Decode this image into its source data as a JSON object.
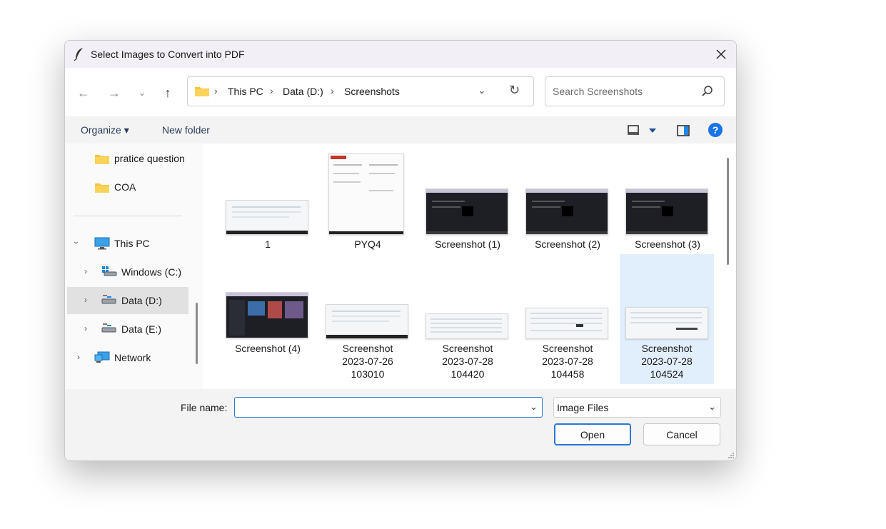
{
  "window": {
    "title": "Select Images to Convert into PDF"
  },
  "navigation": {
    "breadcrumb": [
      "This PC",
      "Data (D:)",
      "Screenshots"
    ],
    "search_placeholder": "Search Screenshots"
  },
  "toolbar": {
    "organize_label": "Organize ▾",
    "new_folder_label": "New folder"
  },
  "sidebar": {
    "items": [
      {
        "label": "pratice question",
        "icon": "folder-icon"
      },
      {
        "label": "COA",
        "icon": "folder-icon"
      },
      {
        "label": "This PC",
        "icon": "pc-icon"
      },
      {
        "label": "Windows (C:)",
        "icon": "drive-icon"
      },
      {
        "label": "Data (D:)",
        "icon": "drive-icon",
        "selected": true
      },
      {
        "label": "Data (E:)",
        "icon": "drive-icon"
      },
      {
        "label": "Network",
        "icon": "network-icon"
      }
    ]
  },
  "files": {
    "items": [
      {
        "name": "1",
        "name2": "",
        "name3": ""
      },
      {
        "name": "PYQ4",
        "name2": "",
        "name3": ""
      },
      {
        "name": "Screenshot (1)",
        "name2": "",
        "name3": ""
      },
      {
        "name": "Screenshot (2)",
        "name2": "",
        "name3": ""
      },
      {
        "name": "Screenshot (3)",
        "name2": "",
        "name3": ""
      },
      {
        "name": "Screenshot (4)",
        "name2": "",
        "name3": ""
      },
      {
        "name": "Screenshot",
        "name2": "2023-07-26",
        "name3": "103010"
      },
      {
        "name": "Screenshot",
        "name2": "2023-07-28",
        "name3": "104420"
      },
      {
        "name": "Screenshot",
        "name2": "2023-07-28",
        "name3": "104458"
      },
      {
        "name": "Screenshot",
        "name2": "2023-07-28",
        "name3": "104524",
        "selected": true
      }
    ]
  },
  "footer": {
    "file_name_label": "File name:",
    "file_name_value": "",
    "file_type": "Image Files",
    "open_label": "Open",
    "cancel_label": "Cancel"
  },
  "colors": {
    "accent": "#2a78d2",
    "selection": "#e1eefb",
    "folder": "#f8c43a",
    "help": "#1a73e8"
  }
}
